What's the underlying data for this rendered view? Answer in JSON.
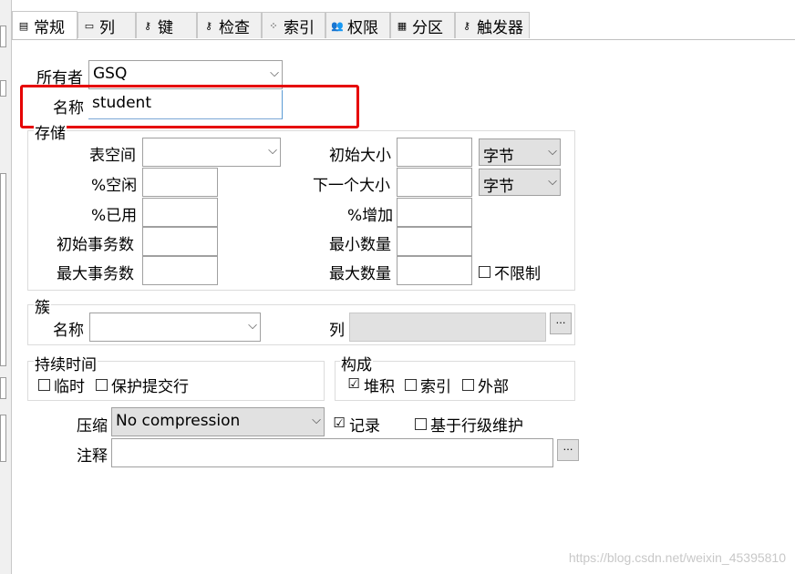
{
  "tabs": [
    {
      "label": "常规",
      "icon": "general-icon",
      "glyph": "▤",
      "active": true
    },
    {
      "label": "列",
      "icon": "columns-icon",
      "glyph": "▭",
      "active": false
    },
    {
      "label": "键",
      "icon": "key-icon",
      "glyph": "⚷",
      "active": false
    },
    {
      "label": "检查",
      "icon": "check-icon",
      "glyph": "⚷",
      "active": false
    },
    {
      "label": "索引",
      "icon": "index-icon",
      "glyph": "⁘",
      "active": false
    },
    {
      "label": "权限",
      "icon": "privileges-icon",
      "glyph": "👥",
      "active": false
    },
    {
      "label": "分区",
      "icon": "partition-icon",
      "glyph": "▦",
      "active": false
    },
    {
      "label": "触发器",
      "icon": "trigger-icon",
      "glyph": "⚷",
      "active": false
    }
  ],
  "general": {
    "owner_label": "所有者",
    "owner_value": "GSQ",
    "name_label": "名称",
    "name_value": "student"
  },
  "storage": {
    "title": "存储",
    "tablespace_label": "表空间",
    "tablespace_value": "",
    "pctfree_label": "%空闲",
    "pctused_label": "%已用",
    "initrans_label": "初始事务数",
    "maxtrans_label": "最大事务数",
    "initial_label": "初始大小",
    "initial_unit": "字节",
    "next_label": "下一个大小",
    "next_unit": "字节",
    "pctincrease_label": "%增加",
    "minextents_label": "最小数量",
    "maxextents_label": "最大数量",
    "unlimited_label": "不限制",
    "unlimited_checked": false
  },
  "cluster": {
    "title": "簇",
    "name_label": "名称",
    "columns_label": "列",
    "more_glyph": "…"
  },
  "duration": {
    "title": "持续时间",
    "temporary_label": "临时",
    "preserve_label": "保护提交行",
    "temporary_checked": false,
    "preserve_checked": false
  },
  "organization": {
    "title": "构成",
    "heap_label": "堆积",
    "index_label": "索引",
    "external_label": "外部",
    "heap_checked": true,
    "index_checked": false,
    "external_checked": false
  },
  "misc": {
    "compress_label": "压缩",
    "compress_value": "No compression",
    "logging_label": "记录",
    "logging_checked": true,
    "rowlevel_label": "基于行级维护",
    "rowlevel_checked": false,
    "comment_label": "注释",
    "comment_more": "…"
  },
  "checkmark": "☑",
  "dropdown_glyph": "⌵",
  "watermark": "https://blog.csdn.net/weixin_45395810",
  "colors": {
    "highlight": "#e60000"
  }
}
